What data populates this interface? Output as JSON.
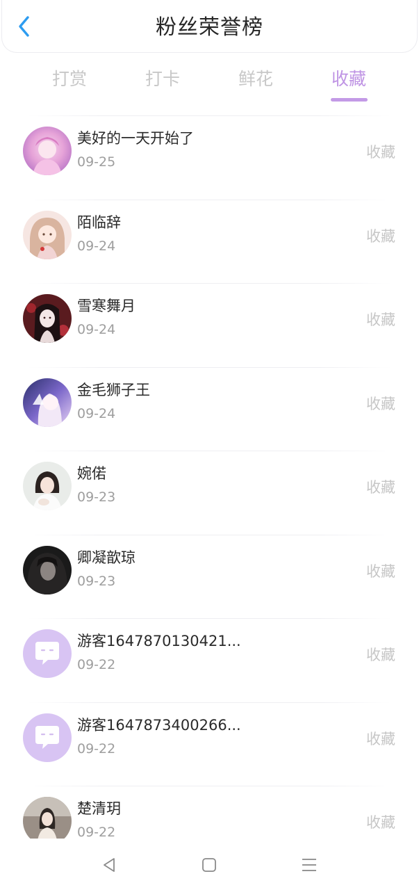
{
  "header": {
    "title": "粉丝荣誉榜"
  },
  "tabs": [
    {
      "label": "打赏",
      "active": false
    },
    {
      "label": "打卡",
      "active": false
    },
    {
      "label": "鲜花",
      "active": false
    },
    {
      "label": "收藏",
      "active": true
    }
  ],
  "list": [
    {
      "name": "美好的一天开始了",
      "date": "09-25",
      "action": "收藏",
      "avatar": "photo-pink-anime"
    },
    {
      "name": "陌临辞",
      "date": "09-24",
      "action": "收藏",
      "avatar": "photo-anime-girl"
    },
    {
      "name": "雪寒舞月",
      "date": "09-24",
      "action": "收藏",
      "avatar": "photo-dark-red"
    },
    {
      "name": "金毛狮子王",
      "date": "09-24",
      "action": "收藏",
      "avatar": "photo-violet"
    },
    {
      "name": "婉偌",
      "date": "09-23",
      "action": "收藏",
      "avatar": "photo-girl-white"
    },
    {
      "name": "卿凝歆琼",
      "date": "09-23",
      "action": "收藏",
      "avatar": "photo-dark"
    },
    {
      "name": "游客1647870130421...",
      "date": "09-22",
      "action": "收藏",
      "avatar": "chat-bubble-icon"
    },
    {
      "name": "游客1647873400266...",
      "date": "09-22",
      "action": "收藏",
      "avatar": "chat-bubble-icon"
    },
    {
      "name": "楚清玥",
      "date": "09-22",
      "action": "收藏",
      "avatar": "photo-outdoor"
    }
  ],
  "navbar": {
    "back": "triangle-back-icon",
    "home": "square-home-icon",
    "menu": "menu-lines-icon"
  },
  "colors": {
    "accent": "#bf94e4",
    "bubble": "#d8c4f3",
    "muted": "#c6c6c6"
  }
}
